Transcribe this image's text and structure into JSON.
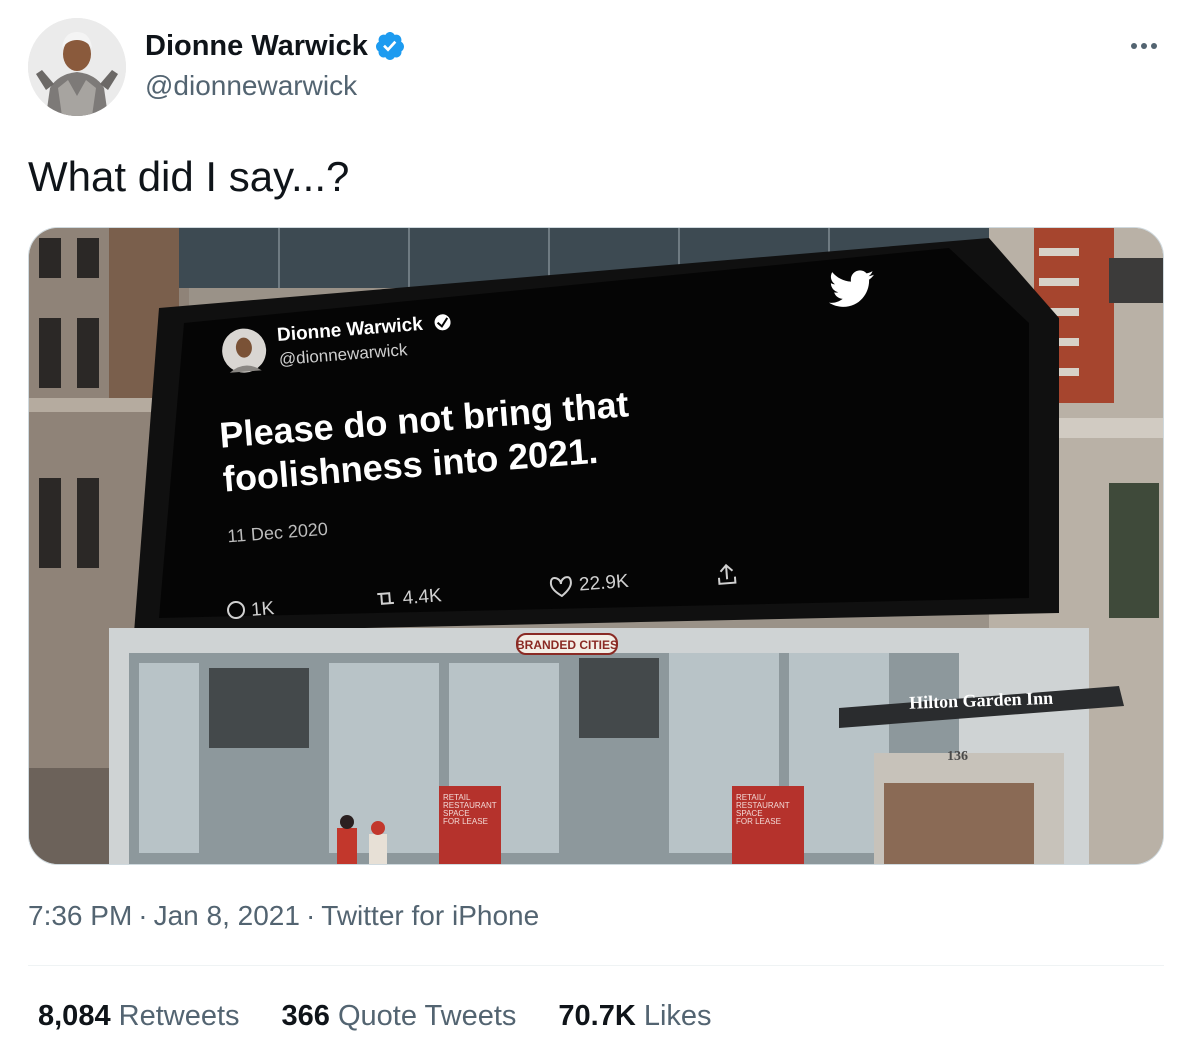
{
  "author": {
    "display_name": "Dionne Warwick",
    "handle": "@dionnewarwick",
    "verified": true,
    "verified_color": "#1d9bf0"
  },
  "tweet": {
    "text": "What did I say...?",
    "time": "7:36 PM",
    "date": "Jan 8, 2021",
    "source": "Twitter for iPhone",
    "separator": "·"
  },
  "stats": {
    "retweets_count": "8,084",
    "retweets_label": "Retweets",
    "quotes_count": "366",
    "quotes_label": "Quote Tweets",
    "likes_count": "70.7K",
    "likes_label": "Likes"
  },
  "media": {
    "billboard": {
      "display_name": "Dionne Warwick",
      "handle": "@dionnewarwick",
      "text_line1": "Please do not bring that",
      "text_line2": "foolishness into 2021.",
      "date": "11 Dec 2020",
      "replies": "1K",
      "retweets": "4.4K",
      "likes": "22.9K"
    },
    "signs": {
      "branded": "BRANDED CITIES",
      "hotel": "Hilton Garden Inn",
      "number": "136",
      "lease_left": [
        "RETAIL",
        "RESTAURANT",
        "SPACE",
        "FOR LEASE"
      ],
      "lease_right": [
        "RETAIL/",
        "RESTAURANT",
        "SPACE",
        "FOR LEASE"
      ]
    }
  },
  "icons": {
    "more": "more-options-icon",
    "bird": "twitter-bird-icon",
    "verified": "verified-badge-icon"
  },
  "colors": {
    "text_primary": "#0f1419",
    "text_secondary": "#536471",
    "accent": "#1d9bf0"
  }
}
